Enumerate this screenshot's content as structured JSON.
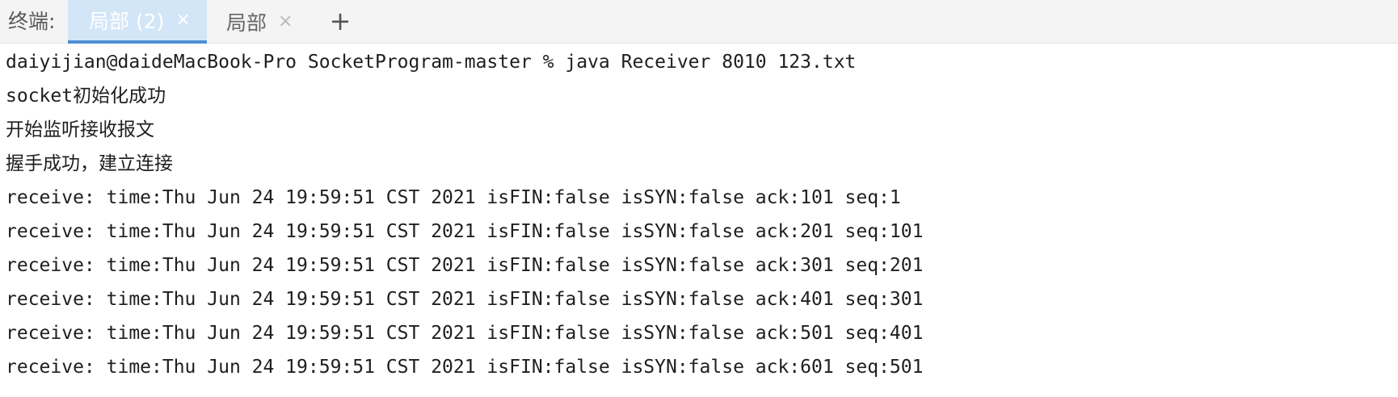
{
  "tabbar": {
    "label": "终端:",
    "tabs": [
      {
        "label": "局部 (2)",
        "close": "×",
        "active": true
      },
      {
        "label": "局部",
        "close": "×",
        "active": false
      }
    ],
    "add_label": "+"
  },
  "terminal": {
    "lines": [
      "daiyijian@daideMacBook-Pro SocketProgram-master % java Receiver 8010 123.txt",
      "socket初始化成功",
      "开始监听接收报文",
      "握手成功，建立连接",
      "receive: time:Thu Jun 24 19:59:51 CST 2021 isFIN:false isSYN:false ack:101 seq:1",
      "receive: time:Thu Jun 24 19:59:51 CST 2021 isFIN:false isSYN:false ack:201 seq:101",
      "receive: time:Thu Jun 24 19:59:51 CST 2021 isFIN:false isSYN:false ack:301 seq:201",
      "receive: time:Thu Jun 24 19:59:51 CST 2021 isFIN:false isSYN:false ack:401 seq:301",
      "receive: time:Thu Jun 24 19:59:51 CST 2021 isFIN:false isSYN:false ack:501 seq:401",
      "receive: time:Thu Jun 24 19:59:51 CST 2021 isFIN:false isSYN:false ack:601 seq:501"
    ]
  },
  "colors": {
    "active_tab_bg": "#d3e6f8",
    "active_tab_underline": "#4f8fd3",
    "tabbar_bg": "#f4f4f4",
    "terminal_text": "#1e1e1e"
  }
}
